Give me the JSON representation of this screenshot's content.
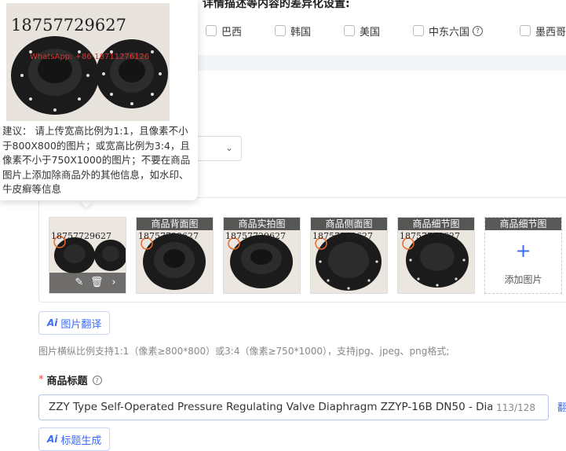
{
  "header": {
    "title": "详情描述等内容的差异化设置:",
    "countries": [
      {
        "label": "巴西",
        "help": false
      },
      {
        "label": "韩国",
        "help": false
      },
      {
        "label": "美国",
        "help": false
      },
      {
        "label": "中东六国",
        "help": true
      },
      {
        "label": "墨西哥",
        "help": false
      }
    ]
  },
  "tooltip": {
    "phone_watermark": "18757729627",
    "whatsapp_watermark": "WhatsApp: +86-18711276126",
    "text": "建议： 请上传宽高比例为1:1，且像素不小于800X800的图片；或宽高比例为3:4，且像素不小于750X1000的图片；不要在商品图片上添加除商品外的其他信息，如水印、牛皮癣等信息"
  },
  "gallery": {
    "thumb_watermark": "18757729627",
    "tiles": [
      {
        "label": ""
      },
      {
        "label": "商品背面图"
      },
      {
        "label": "商品实拍图"
      },
      {
        "label": "商品侧面图"
      },
      {
        "label": "商品细节图"
      }
    ],
    "add_tile": {
      "label": "商品细节图",
      "text": "添加图片"
    }
  },
  "ai_translate_button": {
    "mark": "Ai",
    "label": "图片翻译"
  },
  "hint": "图片横纵比例支持1:1（像素≥800*800）或3:4（像素≥750*1000），支持jpg、jpeg、png格式;",
  "product_title": {
    "label": "商品标题",
    "required_mark": "*",
    "value": "ZZY Type Self-Operated Pressure Regulating Valve Diaphragm ZZYP-16B DN50 - Diaphragm Fo",
    "count": "113/128",
    "edge_link": "翻"
  },
  "title_gen_button": {
    "mark": "Ai",
    "label": "标题生成"
  }
}
